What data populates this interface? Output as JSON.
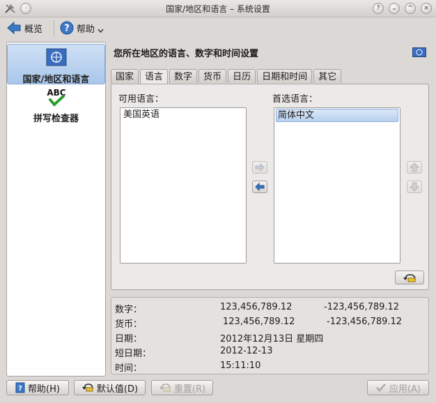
{
  "window": {
    "title": "国家/地区和语言 – 系统设置",
    "buttons": [
      "?",
      "⌄",
      "^",
      "×"
    ]
  },
  "toolbar": {
    "overview_label": "概览",
    "help_label": "帮助"
  },
  "sidebar": {
    "items": [
      {
        "label": "国家/地区和语言"
      },
      {
        "label": "拼写检查器"
      }
    ]
  },
  "main": {
    "title": "您所在地区的语言、数字和时间设置",
    "tabs": [
      "国家",
      "语言",
      "数字",
      "货币",
      "日历",
      "日期和时间",
      "其它"
    ],
    "active_tab": "语言",
    "available_label": "可用语言：",
    "preferred_label": "首选语言：",
    "available_languages": [
      "美国英语"
    ],
    "preferred_languages": [
      "简体中文"
    ]
  },
  "examples": {
    "number_label": "数字：",
    "number_pos": "123,456,789.12",
    "number_neg": "-123,456,789.12",
    "currency_label": "货币：",
    "currency_pos": "123,456,789.12",
    "currency_neg": "-123,456,789.12",
    "date_label": "日期：",
    "date_val": "2012年12月13日 星期四",
    "short_date_label": "短日期：",
    "short_date_val": "2012-12-13",
    "time_label": "时间：",
    "time_val": "15:11:10"
  },
  "bottom": {
    "help": "帮助(H)",
    "defaults": "默认值(D)",
    "reset": "重置(R)",
    "apply": "应用(A)"
  },
  "colors": {
    "accent": "#3a6dbf",
    "check_green": "#2e9b2e"
  }
}
